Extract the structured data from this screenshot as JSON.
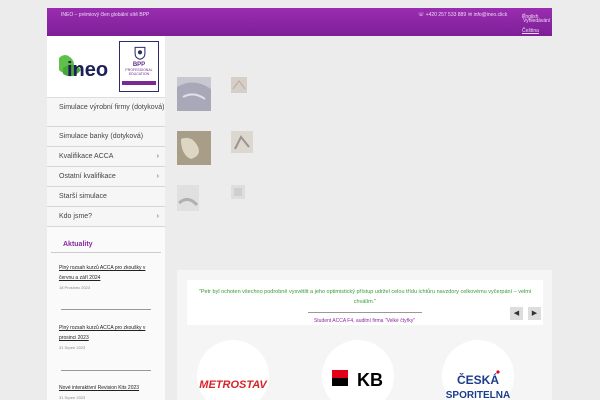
{
  "topbar": {
    "tagline": "INEO – prémiový člen globální sítě BPP",
    "phone": "+420 257 533 889",
    "email": "info@ineo.click",
    "search": "Vyhledávání"
  },
  "languages": [
    "English",
    "Čeština"
  ],
  "logo": {
    "text": "ineo"
  },
  "badge": {
    "line1": "BPP",
    "line2": "PROFESSIONAL",
    "line3": "EDUCATION"
  },
  "nav": [
    {
      "label": "Simulace výrobní firmy (dotyková)",
      "has_submenu": false
    },
    {
      "label": "Simulace banky (dotyková)",
      "has_submenu": false
    },
    {
      "label": "Kvalifikace ACCA",
      "has_submenu": true
    },
    {
      "label": "Ostatní kvalifikace",
      "has_submenu": true
    },
    {
      "label": "Starší simulace",
      "has_submenu": false
    },
    {
      "label": "Kdo jsme?",
      "has_submenu": true
    }
  ],
  "news": {
    "heading": "Aktuality",
    "items": [
      {
        "title": "Plný rozsah kurzů ACCA pro zkoušky v červnu a září 2024",
        "date": "18 Prosinec 2023"
      },
      {
        "title": "Plný rozsah kurzů ACCA pro zkoušky v prosinci 2023",
        "date": "31 Srpen 2023"
      },
      {
        "title": "Nové interaktivní Revision Kits 2023",
        "date": "31 Srpen 2023"
      }
    ]
  },
  "testimonial": {
    "quote": "\"Petr byl ochoten všechno podrobně vysvětlit a jeho optimistický přístup udržel celou třídu ichtůru navzdory celkovému vyčerpání – velmi chválím.\"",
    "author": "Student ACCA F4, auditní firma \"Velké čtyřky\""
  },
  "clients": [
    "METROSTAV",
    "KB",
    "ČESKÁ SPORITELNA"
  ],
  "colors": {
    "brand_purple": "#8a2aa0",
    "quote_green": "#3a9a3a"
  }
}
